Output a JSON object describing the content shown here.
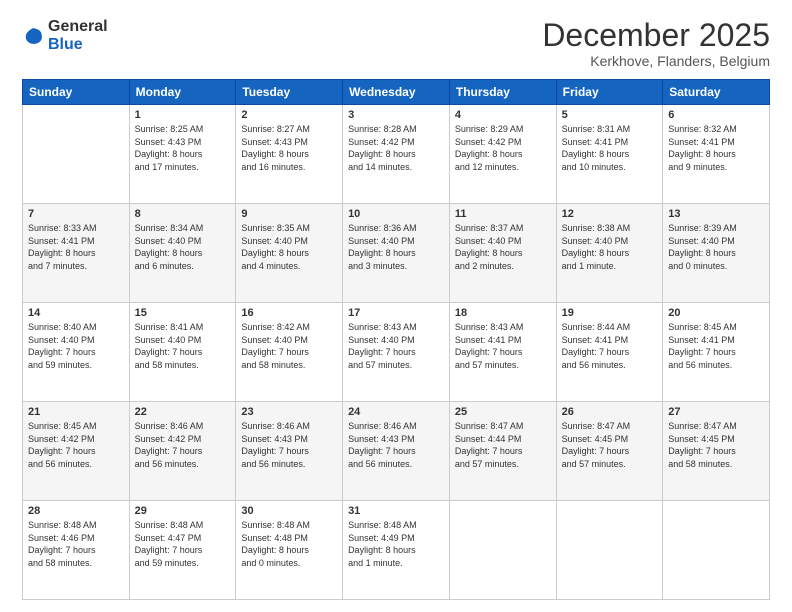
{
  "header": {
    "logo": {
      "general": "General",
      "blue": "Blue"
    },
    "title": "December 2025",
    "subtitle": "Kerkhove, Flanders, Belgium"
  },
  "calendar": {
    "days_of_week": [
      "Sunday",
      "Monday",
      "Tuesday",
      "Wednesday",
      "Thursday",
      "Friday",
      "Saturday"
    ],
    "weeks": [
      [
        {
          "day": "",
          "info": ""
        },
        {
          "day": "1",
          "info": "Sunrise: 8:25 AM\nSunset: 4:43 PM\nDaylight: 8 hours\nand 17 minutes."
        },
        {
          "day": "2",
          "info": "Sunrise: 8:27 AM\nSunset: 4:43 PM\nDaylight: 8 hours\nand 16 minutes."
        },
        {
          "day": "3",
          "info": "Sunrise: 8:28 AM\nSunset: 4:42 PM\nDaylight: 8 hours\nand 14 minutes."
        },
        {
          "day": "4",
          "info": "Sunrise: 8:29 AM\nSunset: 4:42 PM\nDaylight: 8 hours\nand 12 minutes."
        },
        {
          "day": "5",
          "info": "Sunrise: 8:31 AM\nSunset: 4:41 PM\nDaylight: 8 hours\nand 10 minutes."
        },
        {
          "day": "6",
          "info": "Sunrise: 8:32 AM\nSunset: 4:41 PM\nDaylight: 8 hours\nand 9 minutes."
        }
      ],
      [
        {
          "day": "7",
          "info": "Sunrise: 8:33 AM\nSunset: 4:41 PM\nDaylight: 8 hours\nand 7 minutes."
        },
        {
          "day": "8",
          "info": "Sunrise: 8:34 AM\nSunset: 4:40 PM\nDaylight: 8 hours\nand 6 minutes."
        },
        {
          "day": "9",
          "info": "Sunrise: 8:35 AM\nSunset: 4:40 PM\nDaylight: 8 hours\nand 4 minutes."
        },
        {
          "day": "10",
          "info": "Sunrise: 8:36 AM\nSunset: 4:40 PM\nDaylight: 8 hours\nand 3 minutes."
        },
        {
          "day": "11",
          "info": "Sunrise: 8:37 AM\nSunset: 4:40 PM\nDaylight: 8 hours\nand 2 minutes."
        },
        {
          "day": "12",
          "info": "Sunrise: 8:38 AM\nSunset: 4:40 PM\nDaylight: 8 hours\nand 1 minute."
        },
        {
          "day": "13",
          "info": "Sunrise: 8:39 AM\nSunset: 4:40 PM\nDaylight: 8 hours\nand 0 minutes."
        }
      ],
      [
        {
          "day": "14",
          "info": "Sunrise: 8:40 AM\nSunset: 4:40 PM\nDaylight: 7 hours\nand 59 minutes."
        },
        {
          "day": "15",
          "info": "Sunrise: 8:41 AM\nSunset: 4:40 PM\nDaylight: 7 hours\nand 58 minutes."
        },
        {
          "day": "16",
          "info": "Sunrise: 8:42 AM\nSunset: 4:40 PM\nDaylight: 7 hours\nand 58 minutes."
        },
        {
          "day": "17",
          "info": "Sunrise: 8:43 AM\nSunset: 4:40 PM\nDaylight: 7 hours\nand 57 minutes."
        },
        {
          "day": "18",
          "info": "Sunrise: 8:43 AM\nSunset: 4:41 PM\nDaylight: 7 hours\nand 57 minutes."
        },
        {
          "day": "19",
          "info": "Sunrise: 8:44 AM\nSunset: 4:41 PM\nDaylight: 7 hours\nand 56 minutes."
        },
        {
          "day": "20",
          "info": "Sunrise: 8:45 AM\nSunset: 4:41 PM\nDaylight: 7 hours\nand 56 minutes."
        }
      ],
      [
        {
          "day": "21",
          "info": "Sunrise: 8:45 AM\nSunset: 4:42 PM\nDaylight: 7 hours\nand 56 minutes."
        },
        {
          "day": "22",
          "info": "Sunrise: 8:46 AM\nSunset: 4:42 PM\nDaylight: 7 hours\nand 56 minutes."
        },
        {
          "day": "23",
          "info": "Sunrise: 8:46 AM\nSunset: 4:43 PM\nDaylight: 7 hours\nand 56 minutes."
        },
        {
          "day": "24",
          "info": "Sunrise: 8:46 AM\nSunset: 4:43 PM\nDaylight: 7 hours\nand 56 minutes."
        },
        {
          "day": "25",
          "info": "Sunrise: 8:47 AM\nSunset: 4:44 PM\nDaylight: 7 hours\nand 57 minutes."
        },
        {
          "day": "26",
          "info": "Sunrise: 8:47 AM\nSunset: 4:45 PM\nDaylight: 7 hours\nand 57 minutes."
        },
        {
          "day": "27",
          "info": "Sunrise: 8:47 AM\nSunset: 4:45 PM\nDaylight: 7 hours\nand 58 minutes."
        }
      ],
      [
        {
          "day": "28",
          "info": "Sunrise: 8:48 AM\nSunset: 4:46 PM\nDaylight: 7 hours\nand 58 minutes."
        },
        {
          "day": "29",
          "info": "Sunrise: 8:48 AM\nSunset: 4:47 PM\nDaylight: 7 hours\nand 59 minutes."
        },
        {
          "day": "30",
          "info": "Sunrise: 8:48 AM\nSunset: 4:48 PM\nDaylight: 8 hours\nand 0 minutes."
        },
        {
          "day": "31",
          "info": "Sunrise: 8:48 AM\nSunset: 4:49 PM\nDaylight: 8 hours\nand 1 minute."
        },
        {
          "day": "",
          "info": ""
        },
        {
          "day": "",
          "info": ""
        },
        {
          "day": "",
          "info": ""
        }
      ]
    ]
  }
}
